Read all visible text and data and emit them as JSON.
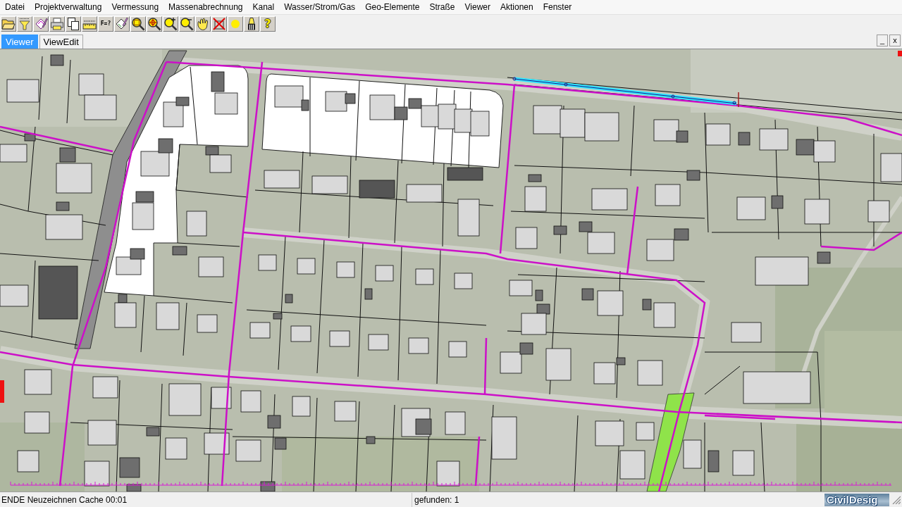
{
  "menu": [
    "Datei",
    "Projektverwaltung",
    "Vermessung",
    "Massenabrechnung",
    "Kanal",
    "Wasser/Strom/Gas",
    "Geo-Elemente",
    "Straße",
    "Viewer",
    "Aktionen",
    "Fenster"
  ],
  "toolbar": [
    {
      "kind": "open-folder"
    },
    {
      "kind": "filter"
    },
    {
      "kind": "layers-pencil"
    },
    {
      "kind": "print"
    },
    {
      "kind": "copy"
    },
    {
      "kind": "measure"
    },
    {
      "kind": "formula",
      "label": "F=?"
    },
    {
      "kind": "diamond-pencil"
    },
    {
      "kind": "zoom-window"
    },
    {
      "kind": "zoom-center"
    },
    {
      "kind": "zoom-in"
    },
    {
      "kind": "zoom-out"
    },
    {
      "kind": "pan"
    },
    {
      "kind": "cross-out"
    },
    {
      "kind": "point"
    },
    {
      "kind": "marker"
    },
    {
      "kind": "help",
      "label": "?"
    }
  ],
  "tabs": [
    {
      "label": "Viewer",
      "selected": true
    },
    {
      "label": "ViewEdit",
      "selected": false
    }
  ],
  "window_controls": [
    "_",
    "x"
  ],
  "status_bar": {
    "message": "ENDE Neuzeichnen Cache 00:01",
    "result": "gefunden: 1",
    "logo": "CivilDesig"
  }
}
